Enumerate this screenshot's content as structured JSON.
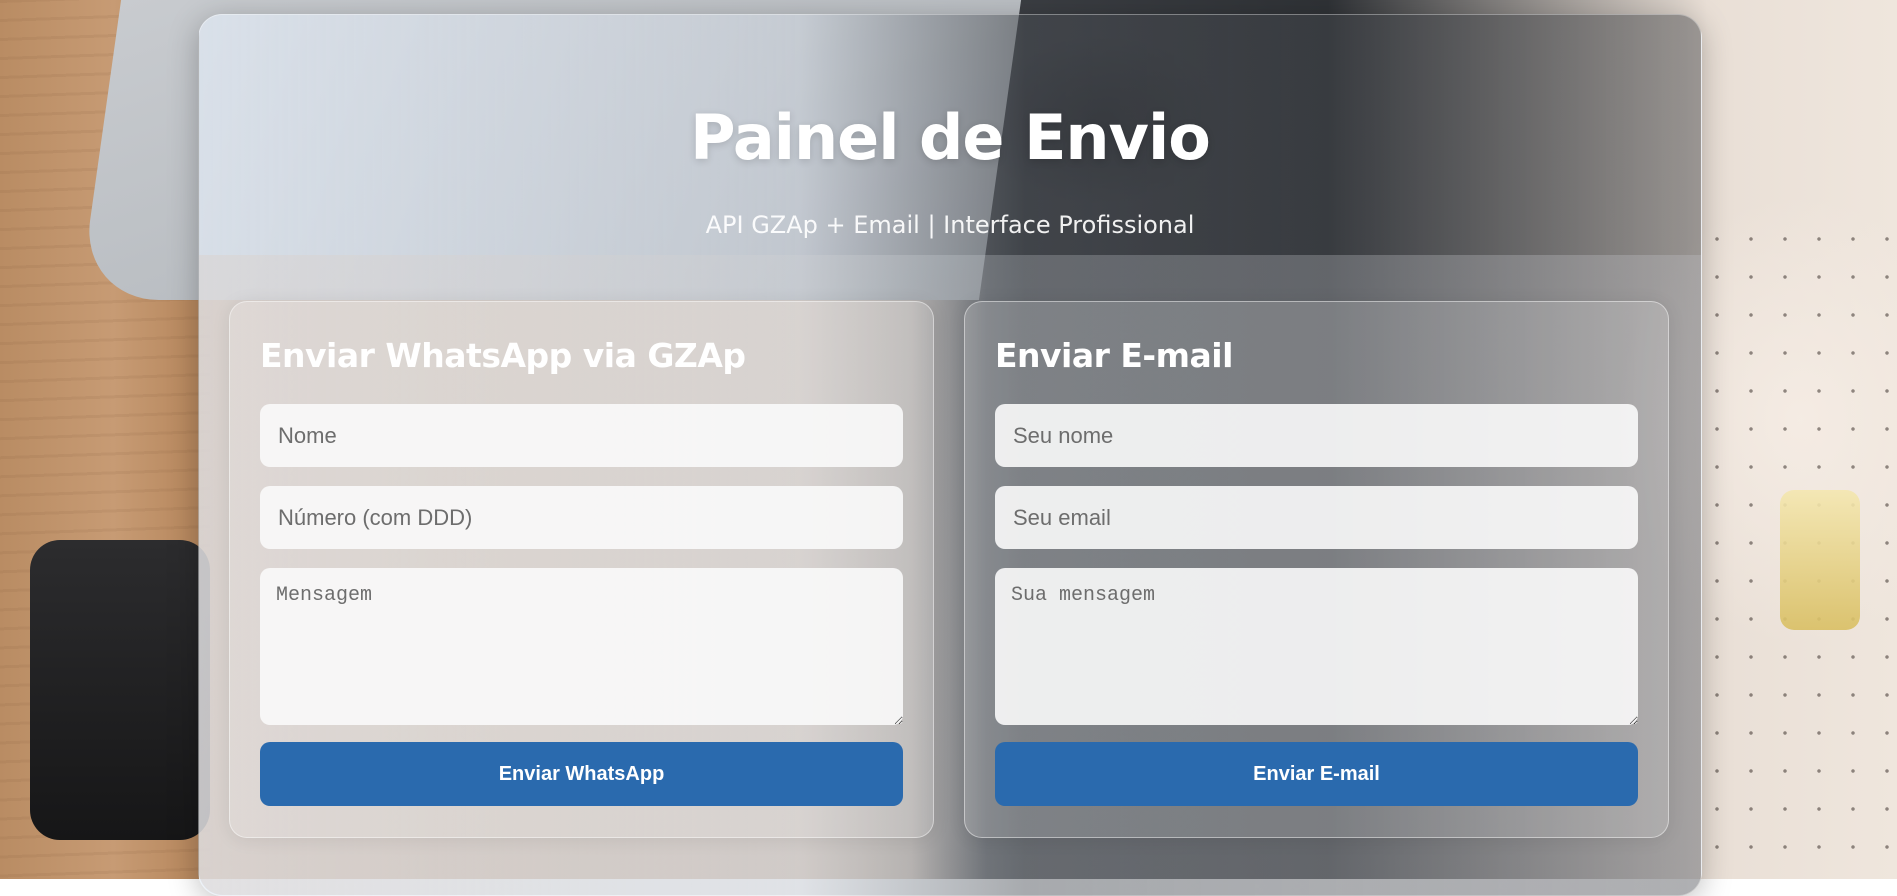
{
  "header": {
    "title": "Painel de Envio",
    "subtitle": "API GZAp + Email | Interface Profissional"
  },
  "whatsapp_form": {
    "heading": "Enviar WhatsApp via GZAp",
    "name_placeholder": "Nome",
    "number_placeholder": "Número (com DDD)",
    "message_placeholder": "Mensagem",
    "submit_label": "Enviar WhatsApp"
  },
  "email_form": {
    "heading": "Enviar E-mail",
    "name_placeholder": "Seu nome",
    "email_placeholder": "Seu email",
    "message_placeholder": "Sua mensagem",
    "submit_label": "Enviar E-mail"
  },
  "colors": {
    "button": "#2a6aae",
    "heading_text": "#ffffff"
  }
}
